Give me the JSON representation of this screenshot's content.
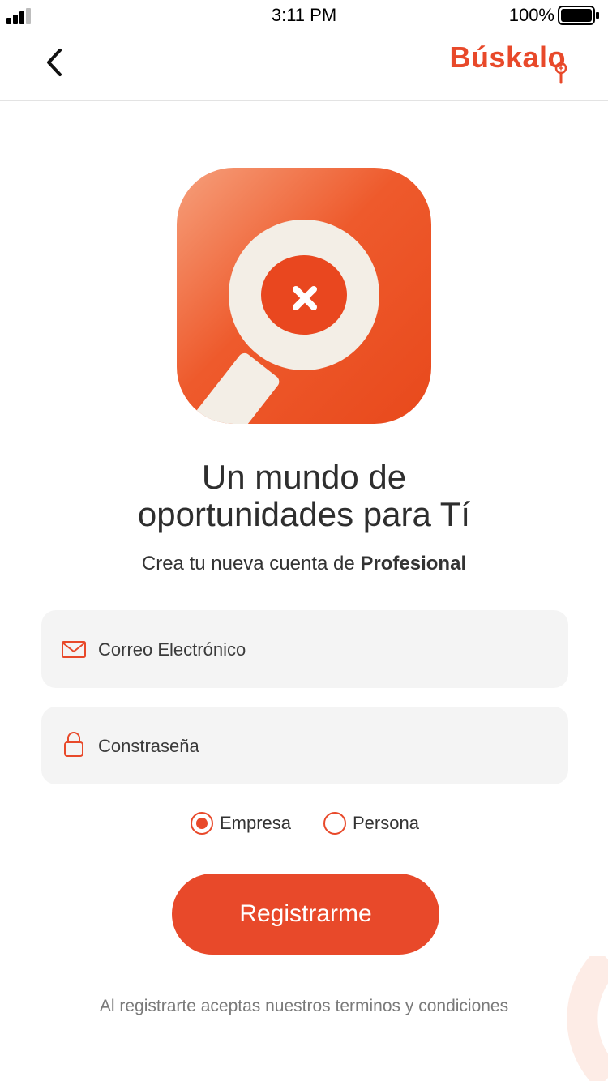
{
  "status_bar": {
    "time": "3:11 PM",
    "battery": "100%"
  },
  "header": {
    "brand": "Búskalo"
  },
  "icons": {
    "back": "chevron-left-icon",
    "logo": "magnifier-icon",
    "email": "envelope-icon",
    "password": "lock-icon"
  },
  "headline": {
    "line1": "Un mundo de",
    "line2": "oportunidades para Tí"
  },
  "subtitle": {
    "prefix": "Crea tu nueva cuenta de ",
    "bold": "Profesional"
  },
  "form": {
    "email_placeholder": "Correo Electrónico",
    "password_placeholder": "Constraseña",
    "account_types": [
      {
        "label": "Empresa",
        "selected": true
      },
      {
        "label": "Persona",
        "selected": false
      }
    ],
    "submit_label": "Registrarme"
  },
  "footer": {
    "terms": "Al registrarte aceptas nuestros terminos y condiciones"
  },
  "colors": {
    "accent": "#e8492a",
    "field_bg": "#f4f4f4",
    "text": "#333333"
  }
}
